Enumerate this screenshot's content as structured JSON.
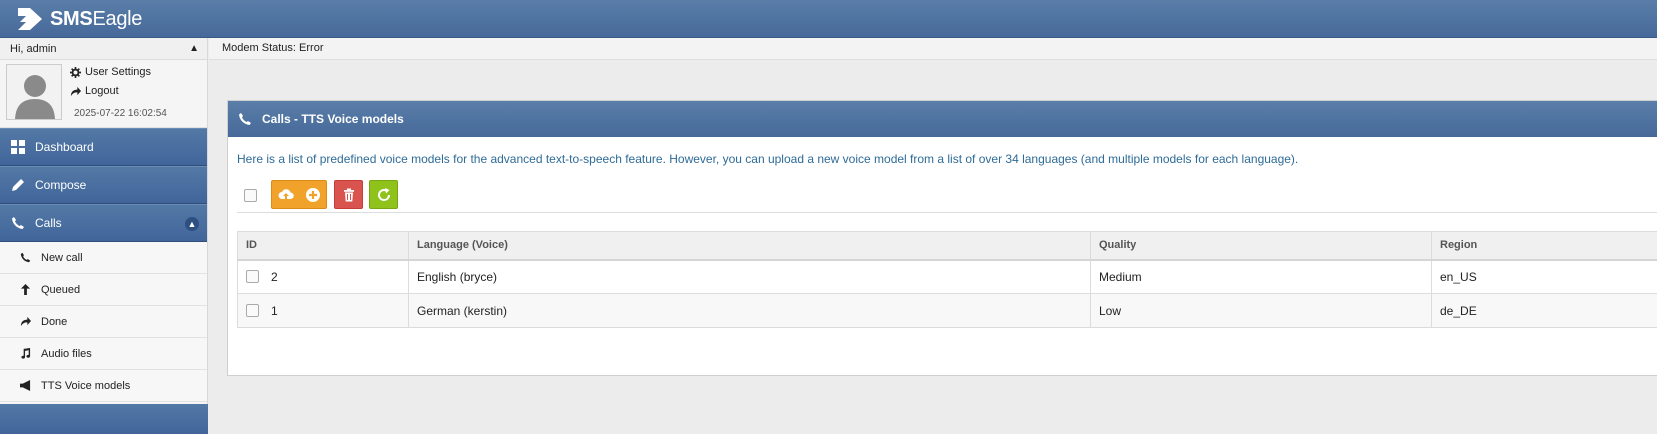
{
  "app": {
    "brand_bold": "SMS",
    "brand_regular": "Eagle"
  },
  "sidebar": {
    "greeting": "Hi, admin",
    "user_settings": "User Settings",
    "logout": "Logout",
    "timestamp": "2025-07-22 16:02:54",
    "main_items": [
      {
        "label": "Dashboard",
        "icon": "dashboard-icon"
      },
      {
        "label": "Compose",
        "icon": "pencil-icon"
      },
      {
        "label": "Calls",
        "icon": "phone-icon",
        "expanded": true
      }
    ],
    "sub_items": [
      {
        "label": "New call",
        "icon": "phone-icon"
      },
      {
        "label": "Queued",
        "icon": "arrow-up-icon"
      },
      {
        "label": "Done",
        "icon": "share-icon"
      },
      {
        "label": "Audio files",
        "icon": "music-icon"
      },
      {
        "label": "TTS Voice models",
        "icon": "megaphone-icon",
        "active": true
      }
    ]
  },
  "status": {
    "text": "Modem Status: Error"
  },
  "panel": {
    "title": "Calls - TTS Voice models",
    "intro": "Here is a list of predefined voice models for the advanced text-to-speech feature. However, you can upload a new voice model from a list of over 34 languages (and multiple models for each language)."
  },
  "toolbar": {
    "buttons": [
      {
        "name": "upload",
        "icon": "cloud-upload-icon",
        "color": "#f0a22b"
      },
      {
        "name": "add",
        "icon": "plus-circle-icon",
        "color": "#f0a22b"
      },
      {
        "name": "delete",
        "icon": "trash-icon",
        "color": "#d9534f"
      },
      {
        "name": "refresh",
        "icon": "refresh-icon",
        "color": "#8fc21a"
      }
    ]
  },
  "table": {
    "headers": [
      "ID",
      "Language (Voice)",
      "Quality",
      "Region"
    ],
    "rows": [
      {
        "id": "2",
        "language": "English (bryce)",
        "quality": "Medium",
        "region": "en_US"
      },
      {
        "id": "1",
        "language": "German (kerstin)",
        "quality": "Low",
        "region": "de_DE"
      }
    ]
  },
  "colors": {
    "header_blue": "#46699a",
    "accent_orange": "#f0a22b",
    "danger_red": "#d9534f",
    "success_green": "#8fc21a",
    "intro_text": "#2e6b97"
  }
}
